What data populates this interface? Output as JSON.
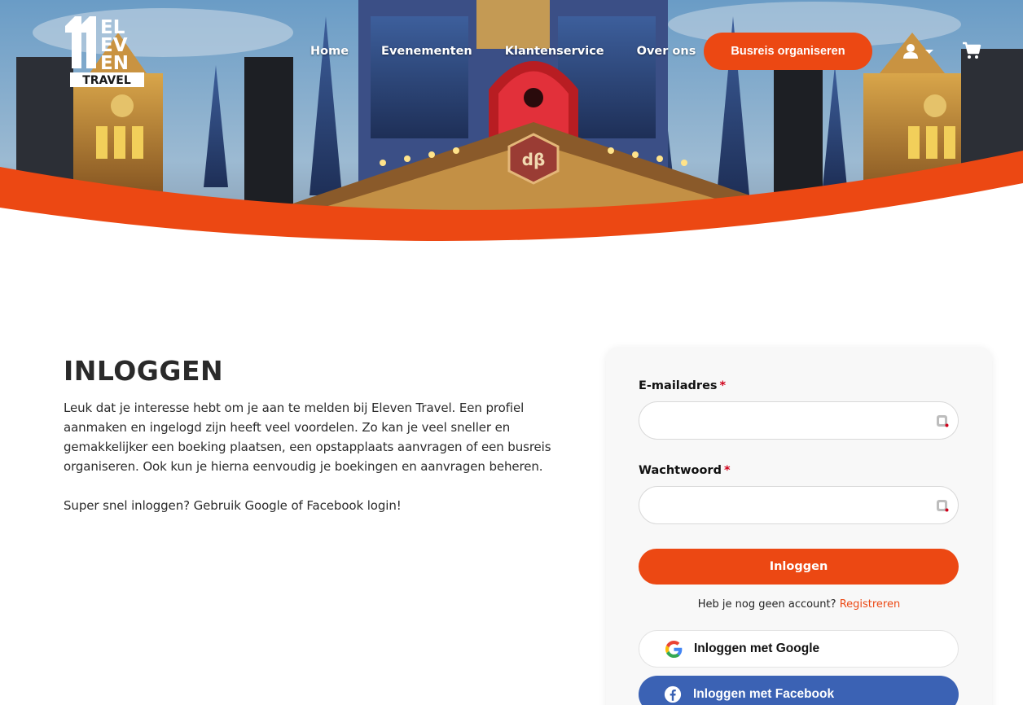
{
  "header": {
    "logo": {
      "line1": "EL",
      "line2": "EV",
      "line3": "EN",
      "badge": "TRAVEL"
    },
    "nav": [
      {
        "label": "Home"
      },
      {
        "label": "Evenementen"
      },
      {
        "label": "Klantenservice"
      },
      {
        "label": "Over ons"
      }
    ],
    "cta_label": "Busreis organiseren",
    "icons": {
      "user": "user-icon",
      "caret": "caret-down-icon",
      "cart": "cart-icon"
    }
  },
  "intro": {
    "title": "INLOGGEN",
    "paragraph1": "Leuk dat je interesse hebt om je aan te melden bij Eleven Travel. Een profiel aanmaken en ingelogd zijn heeft veel voordelen. Zo kan je veel sneller en gemakkelijker een boeking plaatsen, een opstapplaats aanvragen of een busreis organiseren. Ook kun je hierna eenvoudig je boekingen en aanvragen beheren.",
    "paragraph2": "Super snel inloggen? Gebruik Google of Facebook login!"
  },
  "form": {
    "email_label": "E-mailadres",
    "email_value": "",
    "password_label": "Wachtwoord",
    "password_value": "",
    "required_mark": "*",
    "login_button": "Inloggen",
    "no_account_text": "Heb je nog geen account?",
    "register_link": "Registreren",
    "google_button": "Inloggen met Google",
    "facebook_button": "Inloggen met Facebook"
  },
  "colors": {
    "accent": "#ec4813",
    "facebook": "#3b62b4",
    "text": "#2b2b2b"
  }
}
